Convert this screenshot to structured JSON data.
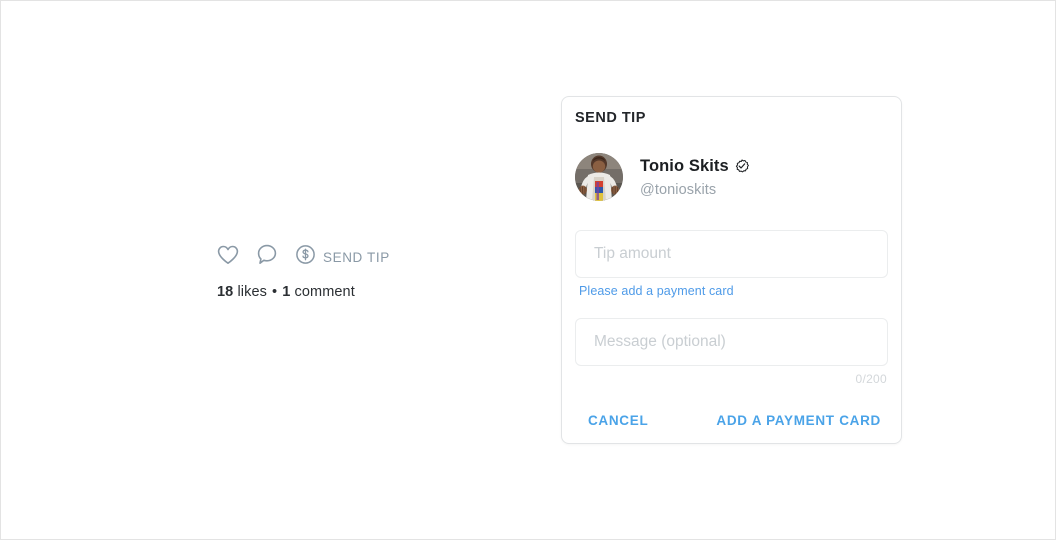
{
  "post_actions": {
    "like_icon": "heart-outline-icon",
    "comment_icon": "comment-bubble-icon",
    "tip_icon": "dollar-circle-icon",
    "send_tip_label": "SEND TIP",
    "likes_count": "18",
    "likes_word": "likes",
    "separator": "•",
    "comments_count": "1",
    "comments_word": "comment"
  },
  "tip_card": {
    "title": "SEND TIP",
    "creator": {
      "name": "Tonio Skits",
      "handle": "@tonioskits",
      "verified_icon": "verified-badge-icon",
      "avatar_icon": "user-photo-avatar"
    },
    "tip_amount": {
      "placeholder": "Tip amount",
      "value": ""
    },
    "payment_hint": "Please add a payment card",
    "message": {
      "placeholder": "Message (optional)",
      "value": ""
    },
    "char_counter": "0/200",
    "cancel_label": "CANCEL",
    "add_card_label": "ADD A PAYMENT CARD"
  },
  "colors": {
    "accent_blue": "#4aa3e8",
    "hint_blue": "#4f9be8",
    "icon_gray": "#8a99a6",
    "text_dark": "#23262a",
    "placeholder_gray": "#c9ced2",
    "counter_gray": "#d3d7da",
    "border_gray": "#e2e4e6"
  }
}
